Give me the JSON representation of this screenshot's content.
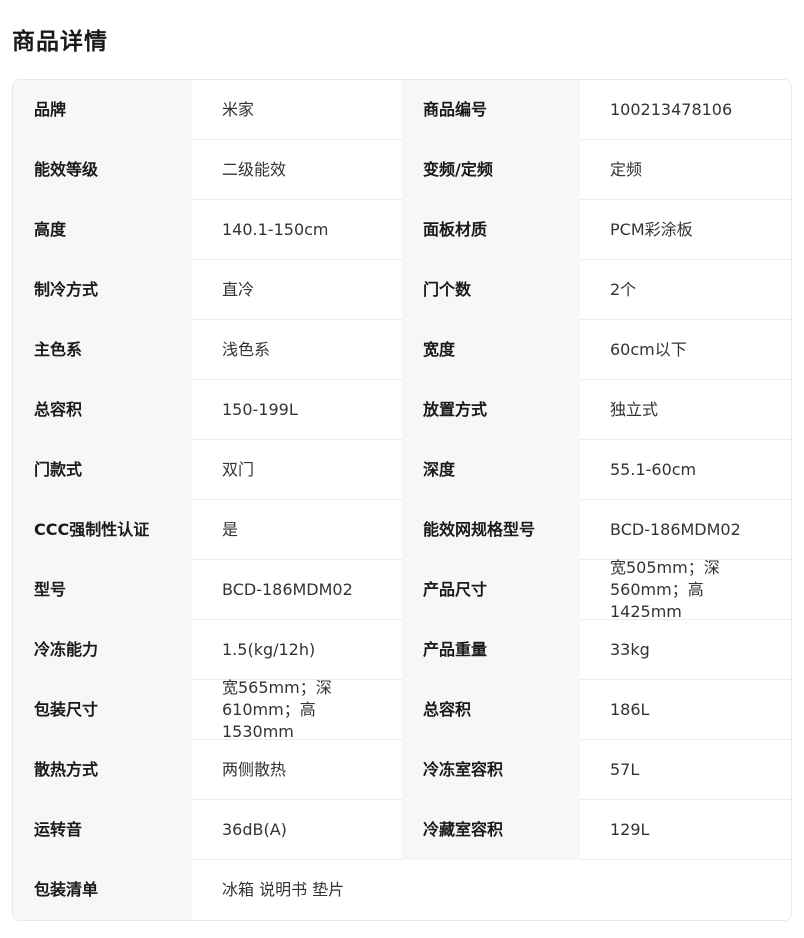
{
  "page": {
    "title": "商品详情"
  },
  "specs": {
    "rows": [
      {
        "l1": "品牌",
        "v1": "米家",
        "l2": "商品编号",
        "v2": "100213478106"
      },
      {
        "l1": "能效等级",
        "v1": "二级能效",
        "l2": "变频/定频",
        "v2": "定频"
      },
      {
        "l1": "高度",
        "v1": "140.1-150cm",
        "l2": "面板材质",
        "v2": "PCM彩涂板"
      },
      {
        "l1": "制冷方式",
        "v1": "直冷",
        "l2": "门个数",
        "v2": "2个"
      },
      {
        "l1": "主色系",
        "v1": "浅色系",
        "l2": "宽度",
        "v2": "60cm以下"
      },
      {
        "l1": "总容积",
        "v1": "150-199L",
        "l2": "放置方式",
        "v2": "独立式"
      },
      {
        "l1": "门款式",
        "v1": "双门",
        "l2": "深度",
        "v2": "55.1-60cm"
      },
      {
        "l1": "CCC强制性认证",
        "v1": "是",
        "l2": "能效网规格型号",
        "v2": "BCD-186MDM02"
      },
      {
        "l1": "型号",
        "v1": "BCD-186MDM02",
        "l2": "产品尺寸",
        "v2": "宽505mm；深560mm；高1425mm"
      },
      {
        "l1": "冷冻能力",
        "v1": "1.5(kg/12h)",
        "l2": "产品重量",
        "v2": "33kg"
      },
      {
        "l1": "包装尺寸",
        "v1": "宽565mm；深610mm；高1530mm",
        "l2": "总容积",
        "v2": "186L"
      },
      {
        "l1": "散热方式",
        "v1": "两侧散热",
        "l2": "冷冻室容积",
        "v2": "57L"
      },
      {
        "l1": "运转音",
        "v1": "36dB(A)",
        "l2": "冷藏室容积",
        "v2": "129L"
      }
    ],
    "last_row": {
      "l1": "包装清单",
      "v1": "冰箱 说明书 垫片"
    }
  }
}
